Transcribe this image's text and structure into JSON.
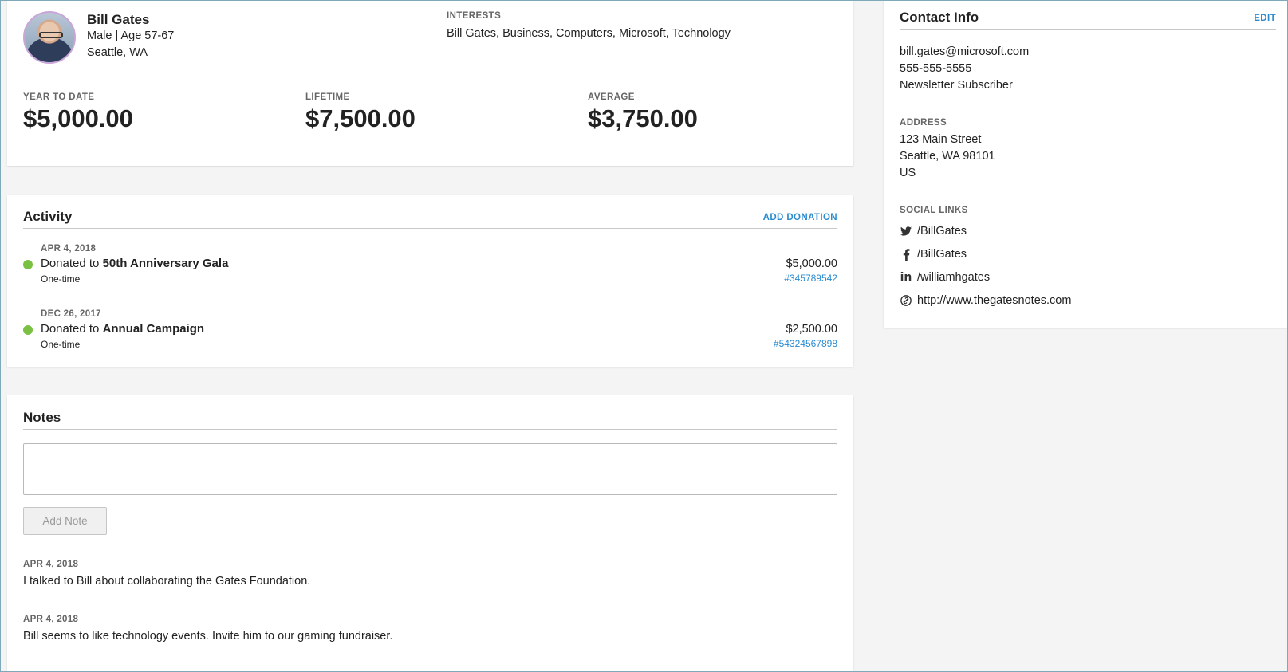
{
  "profile": {
    "name": "Bill Gates",
    "gender_age": "Male | Age 57-67",
    "location": "Seattle, WA",
    "interests_label": "INTERESTS",
    "interests": "Bill Gates, Business, Computers, Microsoft, Technology",
    "stats": [
      {
        "label": "YEAR TO DATE",
        "value": "$5,000.00"
      },
      {
        "label": "LIFETIME",
        "value": "$7,500.00"
      },
      {
        "label": "AVERAGE",
        "value": "$3,750.00"
      }
    ]
  },
  "activity": {
    "title": "Activity",
    "add_label": "ADD DONATION",
    "items": [
      {
        "date": "APR 4, 2018",
        "prefix": "Donated to ",
        "campaign": "50th Anniversary Gala",
        "frequency": "One-time",
        "amount": "$5,000.00",
        "ref": "#345789542"
      },
      {
        "date": "DEC 26, 2017",
        "prefix": "Donated to ",
        "campaign": "Annual Campaign",
        "frequency": "One-time",
        "amount": "$2,500.00",
        "ref": "#54324567898"
      }
    ]
  },
  "notes": {
    "title": "Notes",
    "input_value": "",
    "add_button": "Add Note",
    "items": [
      {
        "date": "APR 4, 2018",
        "text": "I talked to Bill about collaborating the Gates Foundation."
      },
      {
        "date": "APR 4, 2018",
        "text": "Bill seems to like technology events. Invite him to our gaming fundraiser."
      }
    ]
  },
  "contact": {
    "title": "Contact Info",
    "edit_label": "EDIT",
    "email": "bill.gates@microsoft.com",
    "phone": "555-555-5555",
    "subscription": "Newsletter Subscriber",
    "address_label": "ADDRESS",
    "address_line1": "123 Main Street",
    "address_line2": "Seattle, WA 98101",
    "address_country": "US",
    "social_label": "SOCIAL LINKS",
    "social": [
      {
        "icon": "twitter-icon",
        "text": "/BillGates"
      },
      {
        "icon": "facebook-icon",
        "text": "/BillGates"
      },
      {
        "icon": "linkedin-icon",
        "text": "/williamhgates"
      },
      {
        "icon": "link-icon",
        "text": "http://www.thegatesnotes.com"
      }
    ]
  },
  "colors": {
    "accent_link": "#2a8bd0",
    "status_dot": "#7ac143"
  }
}
